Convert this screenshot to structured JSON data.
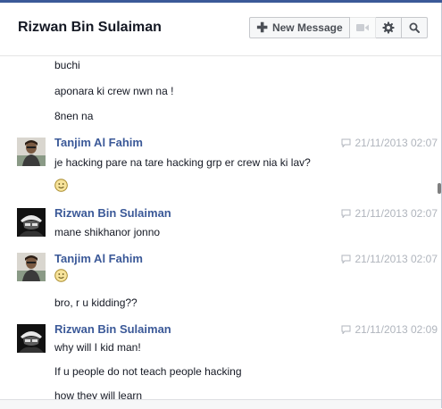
{
  "header": {
    "title": "Rizwan Bin Sulaiman",
    "new_message_label": "New Message",
    "icons": [
      "plus-icon",
      "video-call-icon",
      "gear-icon",
      "search-icon"
    ]
  },
  "messages": {
    "continued_lines": [
      "buchi",
      "aponara ki crew nwn na !",
      "8nen na"
    ],
    "groups": [
      {
        "sender": "Tanjim Al Fahim",
        "timestamp": "21/11/2013 02:07",
        "lines": [
          "je hacking pare na tare hacking grp er crew nia ki lav?"
        ],
        "emoji": "smiley-emoji"
      },
      {
        "sender": "Rizwan Bin Sulaiman",
        "timestamp": "21/11/2013 02:07",
        "lines": [
          "mane shikhanor jonno"
        ]
      },
      {
        "sender": "Tanjim Al Fahim",
        "timestamp": "21/11/2013 02:07",
        "emoji": "smiley-emoji",
        "lines": [
          "bro, r u kidding??"
        ]
      },
      {
        "sender": "Rizwan Bin Sulaiman",
        "timestamp": "21/11/2013 02:09",
        "lines": [
          "why will I kid man!",
          "If u people do not teach people hacking",
          "how they will learn"
        ]
      }
    ]
  },
  "colors": {
    "sender_name": "#3b5998",
    "timestamp": "#b0b5bd",
    "text": "#141823"
  }
}
